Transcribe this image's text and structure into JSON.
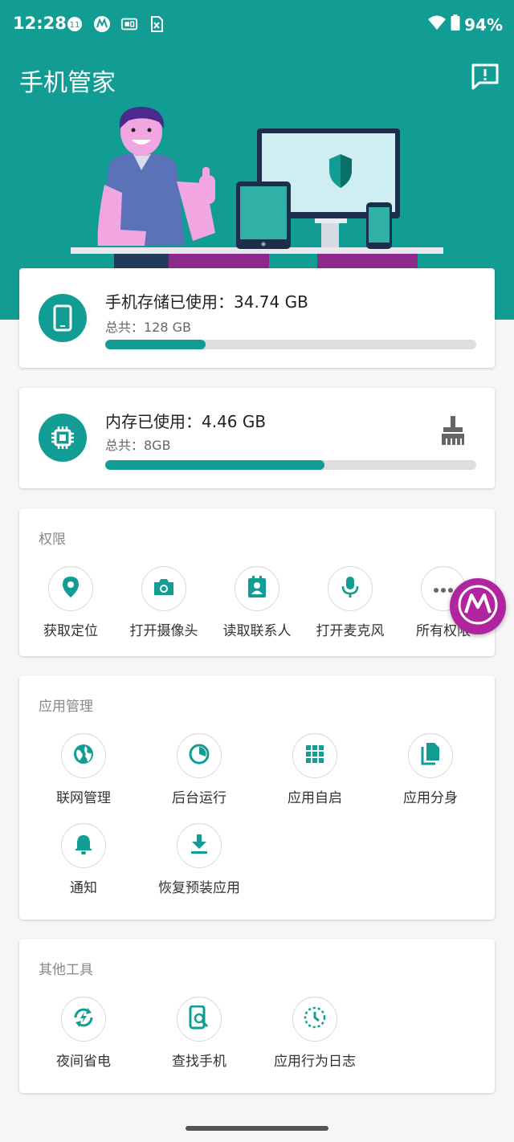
{
  "status_bar": {
    "time": "12:28",
    "battery": "94%",
    "notification_badge": "11"
  },
  "header": {
    "title": "手机管家"
  },
  "storage": {
    "title": "手机存储已使用：34.74 GB",
    "total": "总共：128 GB",
    "used_fraction": 0.27
  },
  "memory": {
    "title": "内存已使用：4.46 GB",
    "total": "总共：8GB",
    "used_fraction": 0.59
  },
  "permissions": {
    "title": "权限",
    "items": [
      {
        "label": "获取定位",
        "icon": "location-icon"
      },
      {
        "label": "打开摄像头",
        "icon": "camera-icon"
      },
      {
        "label": "读取联系人",
        "icon": "contacts-icon"
      },
      {
        "label": "打开麦克风",
        "icon": "microphone-icon"
      },
      {
        "label": "所有权限",
        "icon": "more-icon"
      }
    ]
  },
  "app_management": {
    "title": "应用管理",
    "items": [
      {
        "label": "联网管理",
        "icon": "globe-icon"
      },
      {
        "label": "后台运行",
        "icon": "pie-icon"
      },
      {
        "label": "应用自启",
        "icon": "grid-icon"
      },
      {
        "label": "应用分身",
        "icon": "copy-icon"
      },
      {
        "label": "通知",
        "icon": "bell-icon"
      },
      {
        "label": "恢复预装应用",
        "icon": "download-icon"
      }
    ]
  },
  "other_tools": {
    "title": "其他工具",
    "items": [
      {
        "label": "夜间省电",
        "icon": "battery-saver-icon"
      },
      {
        "label": "查找手机",
        "icon": "find-phone-icon"
      },
      {
        "label": "应用行为日志",
        "icon": "clock-log-icon"
      }
    ]
  },
  "colors": {
    "accent": "#119d94",
    "moto": "#b0259f"
  }
}
